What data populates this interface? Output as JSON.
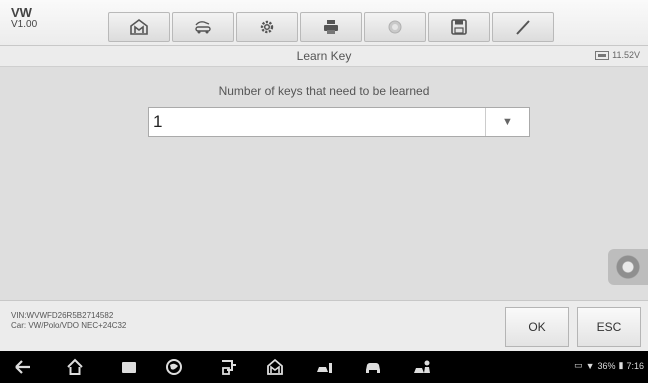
{
  "header": {
    "make": "VW",
    "version": "V1.00",
    "toolbar_icons": [
      "home-icon",
      "vehicle-swap-icon",
      "settings-icon",
      "print-icon",
      "help-icon",
      "save-icon",
      "pen-icon"
    ]
  },
  "titlebar": {
    "title": "Learn Key",
    "battery": "11.52V"
  },
  "main": {
    "prompt": "Number of keys that need to be learned",
    "select_value": "1",
    "select_arrow": "▼"
  },
  "footer": {
    "vin": "VIN:WVWFD26R5B2714582",
    "car": "Car: VW/Polo/VDO NEC+24C32",
    "ok_label": "OK",
    "esc_label": "ESC"
  },
  "navbar": {
    "icons": [
      "back-icon",
      "home-icon",
      "recents-icon",
      "browser-icon",
      "vci-icon",
      "diag-home-icon",
      "service-icon",
      "car-icon",
      "shop-icon"
    ],
    "status": "36%",
    "time": "7:16"
  },
  "colors": {
    "content_bg": "#dedede",
    "header_bg": "#ececec",
    "navbar_bg": "#000000"
  }
}
